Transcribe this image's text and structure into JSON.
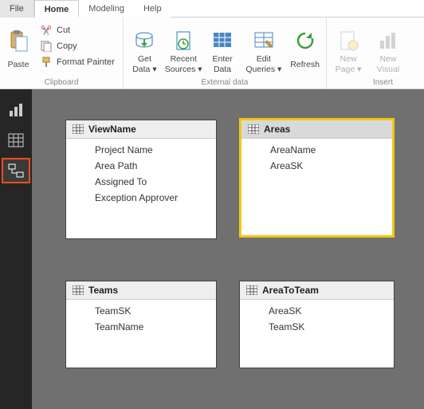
{
  "tabs": {
    "file": "File",
    "home": "Home",
    "modeling": "Modeling",
    "help": "Help"
  },
  "ribbon": {
    "paste": "Paste",
    "cut": "Cut",
    "copy": "Copy",
    "format_painter": "Format Painter",
    "get_data": "Get\nData ▾",
    "recent_sources": "Recent\nSources ▾",
    "enter_data": "Enter\nData",
    "edit_queries": "Edit\nQueries ▾",
    "refresh": "Refresh",
    "new_page": "New\nPage ▾",
    "new_visual": "New\nVisual"
  },
  "groups": {
    "clipboard": "Clipboard",
    "external": "External data",
    "insert": "Insert"
  },
  "tables": {
    "viewname": {
      "title": "ViewName",
      "fields": [
        "Project Name",
        "Area Path",
        "Assigned To",
        "Exception Approver"
      ]
    },
    "areas": {
      "title": "Areas",
      "fields": [
        "AreaName",
        "AreaSK"
      ]
    },
    "teams": {
      "title": "Teams",
      "fields": [
        "TeamSK",
        "TeamName"
      ]
    },
    "areatoteam": {
      "title": "AreaToTeam",
      "fields": [
        "AreaSK",
        "TeamSK"
      ]
    }
  }
}
